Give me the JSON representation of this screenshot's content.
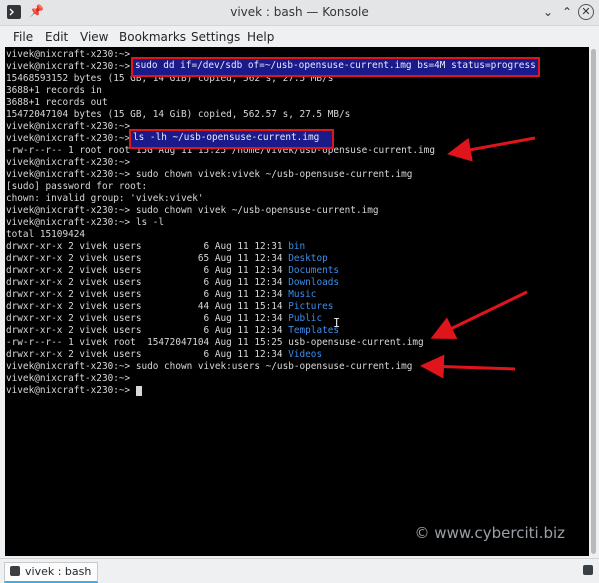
{
  "window": {
    "title": "vivek : bash — Konsole"
  },
  "menu": [
    "File",
    "Edit",
    "View",
    "Bookmarks",
    "Settings",
    "Help"
  ],
  "terminal": {
    "lines": [
      "vivek@nixcraft-x230:~> ",
      "vivek@nixcraft-x230:~> ",
      "15468593152 bytes (15 GB, 14 GiB) copied, 562 s, 27.5 MB/s",
      "3688+1 records in",
      "3688+1 records out",
      "15472047104 bytes (15 GB, 14 GiB) copied, 562.57 s, 27.5 MB/s",
      "vivek@nixcraft-x230:~> ",
      "vivek@nixcraft-x230:~> ",
      "-rw-r--r-- 1 root root 15G Aug 11 15:25 /home/vivek/usb-opensuse-current.img",
      "vivek@nixcraft-x230:~> ",
      "vivek@nixcraft-x230:~> sudo chown vivek:vivek ~/usb-opensuse-current.img",
      "[sudo] password for root:",
      "chown: invalid group: 'vivek:vivek'",
      "vivek@nixcraft-x230:~> sudo chown vivek ~/usb-opensuse-current.img",
      "vivek@nixcraft-x230:~> ls -l",
      "total 15109424"
    ],
    "highlight_1": "sudo dd if=/dev/sdb of=~/usb-opensuse-current.img bs=4M status=progress",
    "highlight_2": "ls -lh ~/usb-opensuse-current.img",
    "listing": [
      {
        "perm": "drwxr-xr-x 2 vivek users           6 Aug 11 12:31 ",
        "name": "bin",
        "dir": true
      },
      {
        "perm": "drwxr-xr-x 2 vivek users          65 Aug 11 12:34 ",
        "name": "Desktop",
        "dir": true
      },
      {
        "perm": "drwxr-xr-x 2 vivek users           6 Aug 11 12:34 ",
        "name": "Documents",
        "dir": true
      },
      {
        "perm": "drwxr-xr-x 2 vivek users           6 Aug 11 12:34 ",
        "name": "Downloads",
        "dir": true
      },
      {
        "perm": "drwxr-xr-x 2 vivek users           6 Aug 11 12:34 ",
        "name": "Music",
        "dir": true
      },
      {
        "perm": "drwxr-xr-x 2 vivek users          44 Aug 11 15:14 ",
        "name": "Pictures",
        "dir": true
      },
      {
        "perm": "drwxr-xr-x 2 vivek users           6 Aug 11 12:34 ",
        "name": "Public",
        "dir": true
      },
      {
        "perm": "drwxr-xr-x 2 vivek users           6 Aug 11 12:34 ",
        "name": "Templates",
        "dir": true
      },
      {
        "perm": "-rw-r--r-- 1 vivek root  15472047104 Aug 11 15:25 ",
        "name": "usb-opensuse-current.img",
        "dir": false
      },
      {
        "perm": "drwxr-xr-x 2 vivek users           6 Aug 11 12:34 ",
        "name": "Videos",
        "dir": true
      }
    ],
    "after": [
      "vivek@nixcraft-x230:~> sudo chown vivek:users ~/usb-opensuse-current.img",
      "vivek@nixcraft-x230:~> ",
      "vivek@nixcraft-x230:~> "
    ]
  },
  "watermark": "© www.cyberciti.biz",
  "tab": {
    "label": "vivek : bash"
  },
  "colors": {
    "highlight_border": "#e0141b",
    "arrow": "#e0141b",
    "dir": "#3b8eea"
  }
}
